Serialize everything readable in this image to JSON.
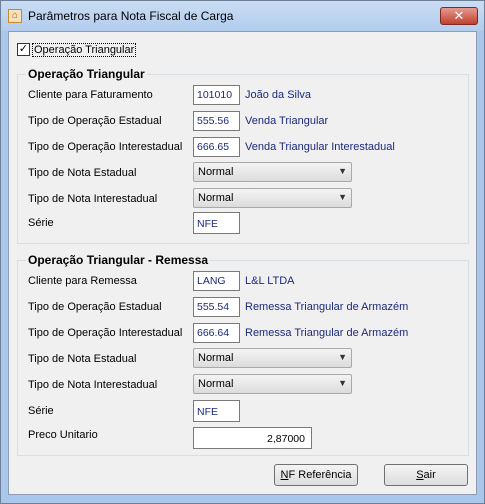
{
  "window": {
    "title": "Parâmetros para Nota Fiscal de Carga",
    "close_glyph": "✕",
    "app_icon": "app-icon"
  },
  "checkbox": {
    "label": "Operação Triangular",
    "checked": true,
    "mark": "✓"
  },
  "group1": {
    "title": "Operação Triangular",
    "cliente_label": "Cliente para Faturamento",
    "cliente_code": "101010",
    "cliente_name": "João da Silva",
    "op_estadual_label": "Tipo de Operação Estadual",
    "op_estadual_code": "555.56",
    "op_estadual_desc": "Venda Triangular",
    "op_inter_label": "Tipo de Operação Interestadual",
    "op_inter_code": "666.65",
    "op_inter_desc": "Venda Triangular Interestadual",
    "nota_estadual_label": "Tipo de Nota Estadual",
    "nota_estadual_value": "Normal",
    "nota_inter_label": "Tipo de Nota Interestadual",
    "nota_inter_value": "Normal",
    "serie_label": "Série",
    "serie_value": "NFE"
  },
  "group2": {
    "title": "Operação Triangular - Remessa",
    "cliente_label": "Cliente para Remessa",
    "cliente_code": "LANG",
    "cliente_name": "L&L LTDA",
    "op_estadual_label": "Tipo de Operação Estadual",
    "op_estadual_code": "555.54",
    "op_estadual_desc": "Remessa Triangular de Armazém",
    "op_inter_label": "Tipo de Operação Interestadual",
    "op_inter_code": "666.64",
    "op_inter_desc": "Remessa Triangular de Armazém",
    "nota_estadual_label": "Tipo de Nota Estadual",
    "nota_estadual_value": "Normal",
    "nota_inter_label": "Tipo de Nota Interestadual",
    "nota_inter_value": "Normal",
    "serie_label": "Série",
    "serie_value": "NFE",
    "preco_label": "Preco Unitario",
    "preco_value": "2,87000"
  },
  "buttons": {
    "nf_ref_access": "N",
    "nf_ref_rest": "F Referência",
    "sair_access": "S",
    "sair_rest": "air"
  },
  "colors": {
    "title_bg": "#b9d1ee",
    "close_bg": "#c7473a",
    "value_text": "#1b2a7a",
    "dialog_bg": "#f0f0f0"
  }
}
